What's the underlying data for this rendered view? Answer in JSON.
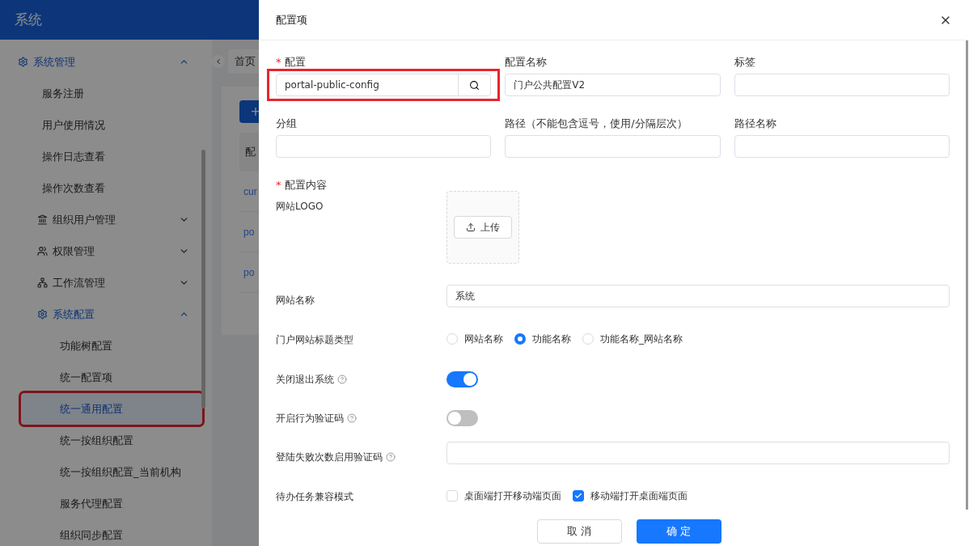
{
  "header": {
    "title": "系统"
  },
  "sidebar": {
    "items": [
      {
        "label": "系统管理",
        "expanded": true,
        "children": [
          {
            "label": "服务注册",
            "selected": false,
            "highlighted": false
          },
          {
            "label": "用户使用情况",
            "selected": false,
            "highlighted": false
          },
          {
            "label": "操作日志查看",
            "selected": false,
            "highlighted": false
          },
          {
            "label": "操作次数查看",
            "selected": false,
            "highlighted": false
          },
          {
            "label": "组织用户管理",
            "expanded": false
          },
          {
            "label": "权限管理",
            "expanded": false
          },
          {
            "label": "工作流管理",
            "expanded": false
          },
          {
            "label": "系统配置",
            "expanded": true,
            "children": [
              {
                "label": "功能树配置",
                "selected": false,
                "highlighted": false
              },
              {
                "label": "统一配置项",
                "selected": false,
                "highlighted": false
              },
              {
                "label": "统一通用配置",
                "selected": true,
                "highlighted": true
              },
              {
                "label": "统一按组织配置",
                "selected": false,
                "highlighted": false
              },
              {
                "label": "统一按组织配置_当前机构",
                "selected": false,
                "highlighted": false
              },
              {
                "label": "服务代理配置",
                "selected": false,
                "highlighted": false
              },
              {
                "label": "组织同步配置",
                "selected": false,
                "highlighted": false
              }
            ]
          }
        ]
      }
    ]
  },
  "tabs": [
    {
      "label": "首页",
      "selected": true
    }
  ],
  "toolbar": {
    "add_button": "+"
  },
  "table": {
    "columns": [
      "配"
    ],
    "rows": [
      [
        "cur"
      ],
      [
        "po"
      ],
      [
        "po"
      ]
    ]
  },
  "drawer": {
    "title": "配置项",
    "fields": [
      {
        "label": "配置",
        "required_mark": "*",
        "kind": "search",
        "value": "portal-public-config",
        "highlighted": true
      },
      {
        "label": "配置名称",
        "kind": "text",
        "value": "门户公共配置V2",
        "highlighted": false
      },
      {
        "label": "标签",
        "kind": "text",
        "highlighted": false
      },
      {
        "label": "分组",
        "kind": "text",
        "highlighted": false
      },
      {
        "label": "路径（不能包含逗号，使用/分隔层次）",
        "kind": "text",
        "highlighted": false
      },
      {
        "label": "路径名称",
        "kind": "text",
        "highlighted": false
      }
    ],
    "content_label": {
      "label": "配置内容",
      "required_mark": "*"
    },
    "settings": [
      {
        "kind": "upload",
        "label": "网站LOGO",
        "help": false,
        "button": "上传"
      },
      {
        "kind": "text",
        "label": "网站名称",
        "help": false,
        "value": "系统"
      },
      {
        "kind": "radio",
        "label": "门户网站标题类型",
        "help": false,
        "options": [
          {
            "label": "网站名称",
            "selected": false
          },
          {
            "label": "功能名称",
            "selected": true
          },
          {
            "label": "功能名称_网站名称",
            "selected": false
          }
        ]
      },
      {
        "kind": "switch",
        "label": "关闭退出系统",
        "help": true,
        "on": true
      },
      {
        "kind": "switch",
        "label": "开启行为验证码",
        "help": true,
        "on": false
      },
      {
        "kind": "text",
        "label": "登陆失败次数启用验证码",
        "help": true
      },
      {
        "kind": "checkboxes",
        "label": "待办任务兼容模式",
        "help": false,
        "options": [
          {
            "label": "桌面端打开移动端页面",
            "checked": false
          },
          {
            "label": "移动端打开桌面端页面",
            "checked": true
          }
        ]
      }
    ],
    "buttons": [
      {
        "label": "取 消",
        "kind": "secondary"
      },
      {
        "label": "确 定",
        "kind": "primary"
      }
    ]
  }
}
